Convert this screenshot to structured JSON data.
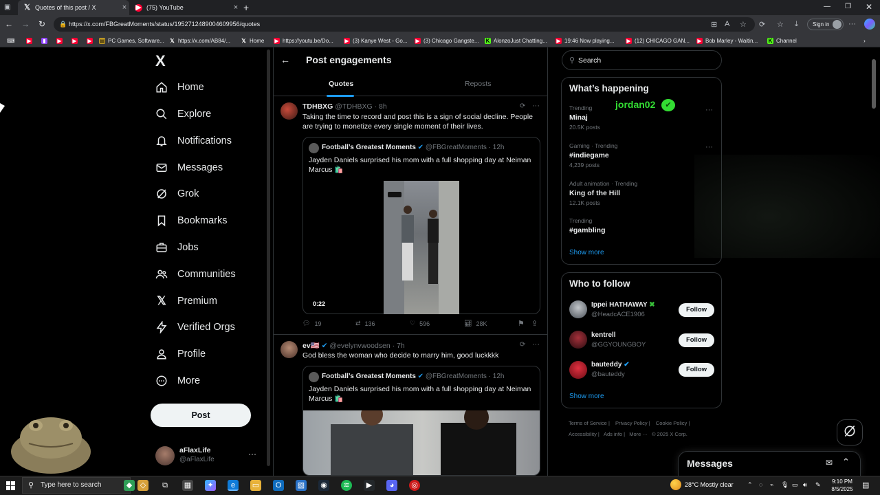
{
  "browser": {
    "tabs": [
      {
        "title": "Quotes of this post / X",
        "active": true
      },
      {
        "title": "(75) YouTube",
        "active": false
      }
    ],
    "url": "https://x.com/FBGreatMoments/status/1952712489004609956/quotes",
    "sign_in": "Sign in",
    "bookmarks": [
      "PC Games, Software...",
      "https://x.com/AB84/...",
      "Home",
      "https://youtu.be/Do...",
      "(3) Kanye West - Go...",
      "(3) Chicago Gangste...",
      "AlonzoJust Chatting...",
      "19:46 Now playing...",
      "(12) CHICAGO GAN...",
      "Bob Marley - Waitin...",
      "Channel"
    ]
  },
  "sidebar": {
    "logo": "X",
    "items": [
      {
        "label": "Home",
        "icon": "home-icon"
      },
      {
        "label": "Explore",
        "icon": "search-icon"
      },
      {
        "label": "Notifications",
        "icon": "bell-icon"
      },
      {
        "label": "Messages",
        "icon": "mail-icon"
      },
      {
        "label": "Grok",
        "icon": "grok-icon"
      },
      {
        "label": "Bookmarks",
        "icon": "bookmark-icon"
      },
      {
        "label": "Jobs",
        "icon": "briefcase-icon"
      },
      {
        "label": "Communities",
        "icon": "people-icon"
      },
      {
        "label": "Premium",
        "icon": "x-icon"
      },
      {
        "label": "Verified Orgs",
        "icon": "lightning-icon"
      },
      {
        "label": "Profile",
        "icon": "person-icon"
      },
      {
        "label": "More",
        "icon": "more-circle-icon"
      }
    ],
    "post_button": "Post",
    "account": {
      "name": "aFlaxLife",
      "handle": "@aFlaxLife"
    }
  },
  "header": {
    "title": "Post engagements",
    "tabs": [
      "Quotes",
      "Reposts"
    ],
    "active_tab": "Quotes"
  },
  "quotes": [
    {
      "name": "TDHBXG",
      "handle": "@TDHBXG",
      "time": "· 8h",
      "text": "Taking the time to record and post this is a sign of social decline. People are trying to monetize every single moment of their lives.",
      "quoted": {
        "name": "Football’s Greatest Moments",
        "handle": "@FBGreatMoments",
        "time": "· 12h",
        "text": "Jayden Daniels surprised his mom with a full shopping day at Neiman Marcus 🛍️",
        "video_duration": "0:22"
      },
      "stats": {
        "replies": "19",
        "reposts": "136",
        "likes": "596",
        "views": "28K"
      }
    },
    {
      "name": "ev🇺🇸",
      "handle": "@evelynvwoodsen",
      "time": "· 7h",
      "text": "God bless the woman who decide to marry him, good luckkkk",
      "quoted": {
        "name": "Football’s Greatest Moments",
        "handle": "@FBGreatMoments",
        "time": "· 12h",
        "text": "Jayden Daniels surprised his mom with a full shopping day at Neiman Marcus 🛍️"
      }
    }
  ],
  "right": {
    "search_placeholder": "Search",
    "happening_title": "What’s happening",
    "overlay_text": "jordan02",
    "trends": [
      {
        "meta": "Trending",
        "name": "Minaj",
        "posts": "20.5K posts"
      },
      {
        "meta": "Gaming · Trending",
        "name": "#indiegame",
        "posts": "4,239 posts"
      },
      {
        "meta": "Adult animation · Trending",
        "name": "King of the Hill",
        "posts": "12.1K posts"
      },
      {
        "meta": "Trending",
        "name": "#gambling",
        "posts": ""
      }
    ],
    "show_more": "Show more",
    "follow_title": "Who to follow",
    "follow": [
      {
        "name": "Ippei HATHAWAY",
        "handle": "@HeadcACE1906",
        "btn": "Follow"
      },
      {
        "name": "kentrell",
        "handle": "@GGYOUNGBOY",
        "btn": "Follow"
      },
      {
        "name": "bauteddy",
        "handle": "@bauteddy",
        "btn": "Follow"
      }
    ],
    "show_more_2": "Show more",
    "footer": [
      "Terms of Service",
      "Privacy Policy",
      "Cookie Policy",
      "Accessibility",
      "Ads info",
      "More ···",
      "© 2025 X Corp."
    ],
    "messages": "Messages"
  },
  "taskbar": {
    "search_placeholder": "Type here to search",
    "weather": "28°C  Mostly clear",
    "time": "9:10 PM",
    "date": "8/5/2025"
  },
  "colors": {
    "accent": "#1d9bf0",
    "bg": "#000000",
    "border": "#2f3336",
    "muted": "#71767b"
  }
}
